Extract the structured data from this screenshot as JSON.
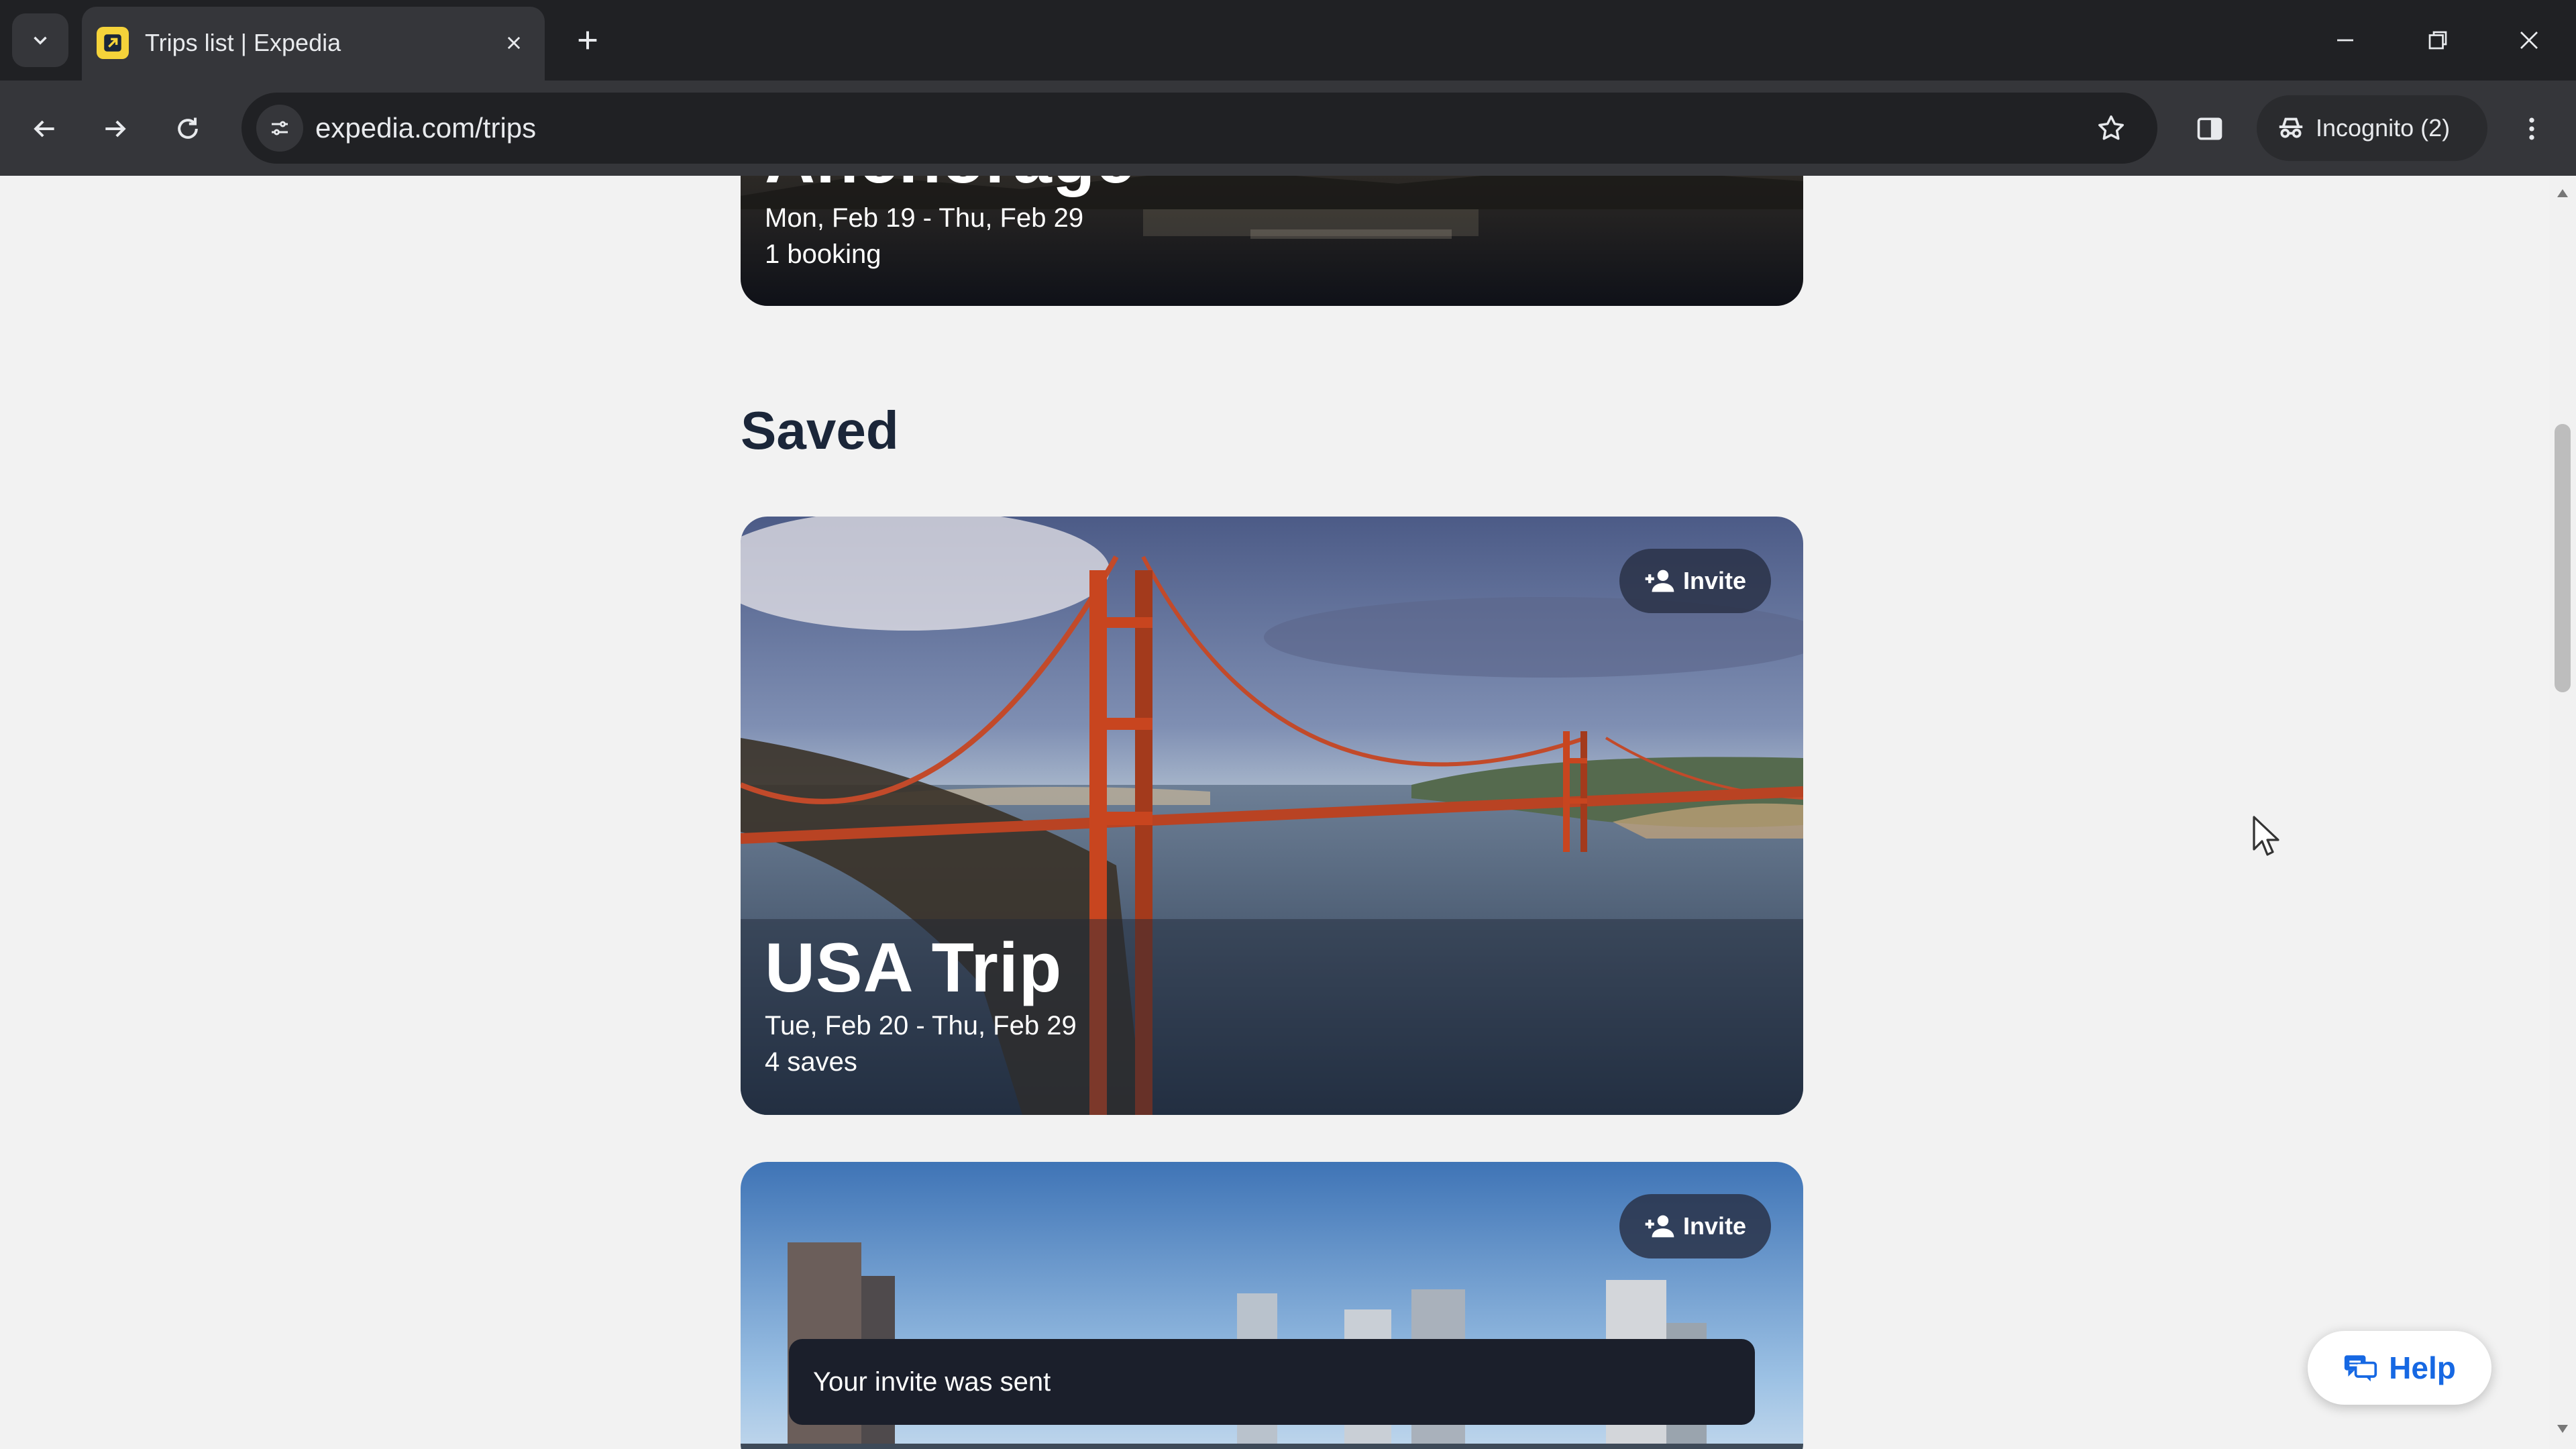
{
  "browser": {
    "tab": {
      "title": "Trips list | Expedia"
    },
    "address_bar": {
      "url": "expedia.com/trips"
    },
    "incognito_label": "Incognito (2)",
    "icons": {
      "tab_search": "chevron-down-icon",
      "close_tab": "close-icon",
      "new_tab": "plus-icon",
      "back": "arrow-left-icon",
      "forward": "arrow-right-icon",
      "reload": "reload-icon",
      "site_info": "tune-icon",
      "bookmark": "star-icon",
      "side_panel": "side-panel-icon",
      "incognito": "incognito-icon",
      "menu": "kebab-menu-icon",
      "minimize": "minimize-icon",
      "restore": "restore-icon",
      "close_window": "close-icon"
    }
  },
  "trips": {
    "anchorage": {
      "title": "Anchorage",
      "dates": "Mon, Feb 19 - Thu, Feb 29",
      "summary": "1 booking"
    }
  },
  "saved": {
    "heading": "Saved",
    "cards": [
      {
        "title": "USA Trip",
        "dates": "Tue, Feb 20 - Thu, Feb 29",
        "summary": "4 saves",
        "invite_label": "Invite"
      },
      {
        "invite_label": "Invite"
      }
    ]
  },
  "toast": {
    "message": "Your invite was sent"
  },
  "help": {
    "label": "Help"
  },
  "colors": {
    "page_background": "#f2f2f2",
    "text_primary": "#1b2639",
    "accent_blue": "#1668e3",
    "toast_background": "#1b1f2b",
    "chrome_dark": "#202124"
  }
}
